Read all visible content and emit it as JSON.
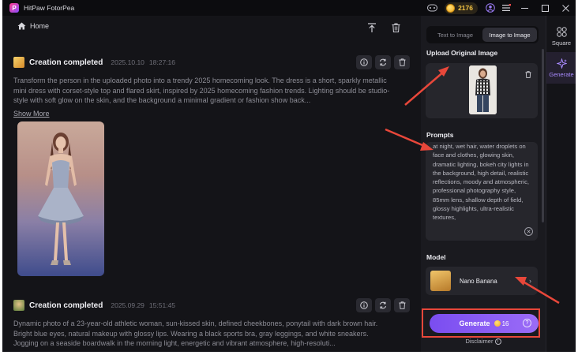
{
  "app": {
    "title": "HitPaw FotorPea",
    "credits": "2176"
  },
  "colors": {
    "accent": "#8a5cf5",
    "annotation": "#e8473a",
    "coin": "#f5c542"
  },
  "header": {
    "home_label": "Home"
  },
  "cards": [
    {
      "title": "Creation completed",
      "date": "2025.10.10",
      "time": "18:27:16",
      "description": "Transform the person in the uploaded photo into a trendy 2025 homecoming look. The dress is a short, sparkly metallic mini dress with corset-style top and flared skirt, inspired by 2025 homecoming fashion trends. Lighting should be studio-style with soft glow on the skin, and the background a minimal gradient or fashion show back...",
      "show_more": "Show More"
    },
    {
      "title": "Creation completed",
      "date": "2025.09.29",
      "time": "15:51:45",
      "description": "Dynamic photo of a 23-year-old athletic woman, sun-kissed skin, defined cheekbones, ponytail with dark brown hair. Bright blue eyes, natural makeup with glossy lips. Wearing a black sports bra, gray leggings, and white sneakers. Jogging on a seaside boardwalk in the morning light, energetic and vibrant atmosphere, high-resoluti..."
    }
  ],
  "right_panel": {
    "tabs": [
      "Text to Image",
      "Image to Image"
    ],
    "active_tab": "Image to Image",
    "upload_title": "Upload Original Image",
    "prompts_title": "Prompts",
    "prompt_text": "at night, wet hair, water droplets on face and clothes, glowing skin, dramatic lighting, bokeh city lights in the background, high detail, realistic reflections, moody and atmospheric, professional photography style, 85mm lens, shallow depth of field, glossy highlights, ultra-realistic textures,",
    "model_title": "Model",
    "model_name": "Nano Banana",
    "generate_label": "Generate",
    "generate_cost": "16",
    "disclaimer": "Disclaimer"
  },
  "nav": [
    {
      "label": "Square",
      "icon": "square-grid-icon"
    },
    {
      "label": "Generate",
      "icon": "sparkle-icon"
    }
  ]
}
